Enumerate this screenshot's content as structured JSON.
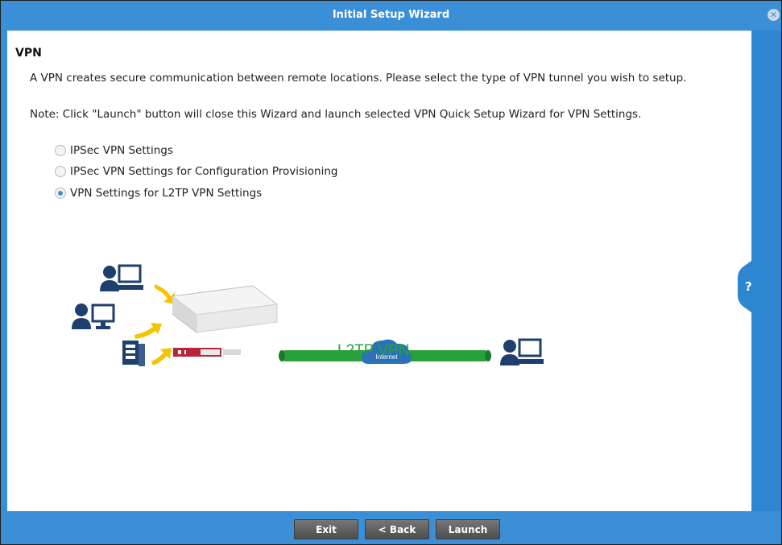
{
  "window": {
    "title": "Initial Setup Wizard"
  },
  "section": {
    "title": "VPN",
    "description": "A VPN creates secure communication between remote locations. Please select the type of VPN tunnel you wish to setup.",
    "note": "Note: Click \"Launch\" button will close this Wizard and launch selected VPN Quick Setup Wizard for VPN Settings."
  },
  "options": [
    {
      "label": "IPSec VPN Settings",
      "checked": false
    },
    {
      "label": "IPSec VPN Settings for Configuration Provisioning",
      "checked": false
    },
    {
      "label": "VPN Settings for L2TP VPN Settings",
      "checked": true
    }
  ],
  "diagram": {
    "cloud_label": "Internet",
    "tunnel_label": "L2TP VPN"
  },
  "help": {
    "label": "?"
  },
  "footer": {
    "exit_label": "Exit",
    "back_label": "< Back",
    "launch_label": "Launch"
  },
  "colors": {
    "accent": "#3a8fd6",
    "tunnel": "#2aa23b",
    "device_red": "#b8243a"
  }
}
